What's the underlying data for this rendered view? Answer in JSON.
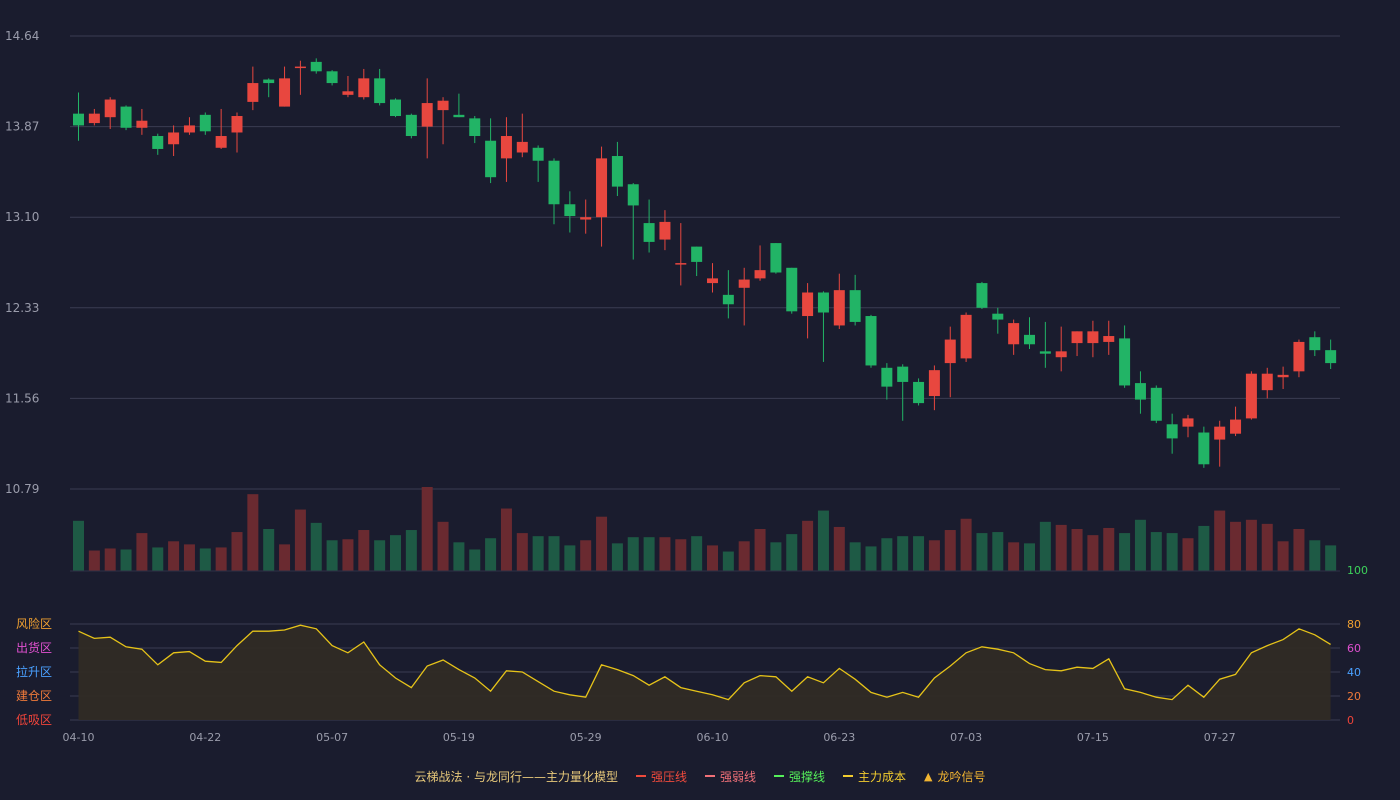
{
  "colors": {
    "background": "#1a1c2e",
    "up": "#e8473f",
    "down": "#22b466",
    "volume_up": "#6a2a30",
    "volume_down": "#1e5a45",
    "grid": "#3a3d52",
    "axis_text": "#9a9cab",
    "oscillator_line": "#e6c319",
    "oscillator_fill": "#302b25"
  },
  "chart_data": [
    {
      "type": "candlestick",
      "name": "price",
      "y_ticks": [
        "14.64",
        "13.87",
        "13.10",
        "12.33",
        "11.56",
        "10.79"
      ],
      "ylim": [
        10.79,
        14.64
      ],
      "x_tick_labels": [
        "04-10",
        "04-22",
        "05-07",
        "05-19",
        "05-29",
        "06-10",
        "06-23",
        "07-03",
        "07-15",
        "07-27"
      ],
      "x_tick_index": [
        0,
        8,
        16,
        24,
        32,
        40,
        48,
        56,
        64,
        72
      ],
      "grid": true,
      "candles": [
        [
          13.98,
          13.88,
          14.16,
          13.75
        ],
        [
          13.9,
          13.98,
          14.02,
          13.88
        ],
        [
          13.95,
          14.1,
          14.12,
          13.85
        ],
        [
          14.04,
          13.86,
          14.05,
          13.84
        ],
        [
          13.86,
          13.92,
          14.02,
          13.8
        ],
        [
          13.79,
          13.68,
          13.81,
          13.63
        ],
        [
          13.72,
          13.82,
          13.88,
          13.62
        ],
        [
          13.82,
          13.88,
          13.95,
          13.8
        ],
        [
          13.97,
          13.83,
          13.99,
          13.8
        ],
        [
          13.69,
          13.79,
          14.02,
          13.68
        ],
        [
          13.82,
          13.96,
          13.99,
          13.65
        ],
        [
          14.08,
          14.24,
          14.38,
          14.01
        ],
        [
          14.27,
          14.24,
          14.28,
          14.12
        ],
        [
          14.04,
          14.28,
          14.38,
          14.04
        ],
        [
          14.37,
          14.38,
          14.43,
          14.14
        ],
        [
          14.42,
          14.34,
          14.45,
          14.32
        ],
        [
          14.34,
          14.24,
          14.35,
          14.22
        ],
        [
          14.14,
          14.17,
          14.3,
          14.12
        ],
        [
          14.12,
          14.28,
          14.36,
          14.1
        ],
        [
          14.28,
          14.07,
          14.36,
          14.05
        ],
        [
          14.1,
          13.96,
          14.11,
          13.95
        ],
        [
          13.97,
          13.79,
          13.98,
          13.77
        ],
        [
          13.87,
          14.07,
          14.28,
          13.6
        ],
        [
          14.01,
          14.09,
          14.12,
          13.72
        ],
        [
          13.97,
          13.95,
          14.15,
          13.95
        ],
        [
          13.94,
          13.79,
          13.96,
          13.73
        ],
        [
          13.75,
          13.44,
          13.94,
          13.39
        ],
        [
          13.6,
          13.79,
          13.95,
          13.4
        ],
        [
          13.65,
          13.74,
          13.98,
          13.61
        ],
        [
          13.69,
          13.58,
          13.71,
          13.4
        ],
        [
          13.58,
          13.21,
          13.6,
          13.04
        ],
        [
          13.21,
          13.11,
          13.32,
          12.97
        ],
        [
          13.08,
          13.1,
          13.25,
          12.96
        ],
        [
          13.1,
          13.6,
          13.7,
          12.85
        ],
        [
          13.62,
          13.36,
          13.74,
          13.28
        ],
        [
          13.38,
          13.2,
          13.39,
          12.74
        ],
        [
          13.05,
          12.89,
          13.25,
          12.8
        ],
        [
          12.91,
          13.06,
          13.16,
          12.82
        ],
        [
          12.71,
          12.71,
          13.05,
          12.52
        ],
        [
          12.85,
          12.72,
          12.85,
          12.6
        ],
        [
          12.54,
          12.58,
          12.71,
          12.46
        ],
        [
          12.44,
          12.36,
          12.65,
          12.24
        ],
        [
          12.5,
          12.57,
          12.67,
          12.18
        ],
        [
          12.58,
          12.65,
          12.86,
          12.56
        ],
        [
          12.88,
          12.63,
          12.88,
          12.62
        ],
        [
          12.67,
          12.3,
          12.67,
          12.28
        ],
        [
          12.26,
          12.46,
          12.54,
          12.07
        ],
        [
          12.46,
          12.29,
          12.47,
          11.87
        ],
        [
          12.18,
          12.48,
          12.62,
          12.15
        ],
        [
          12.48,
          12.21,
          12.61,
          12.18
        ],
        [
          12.26,
          11.84,
          12.27,
          11.82
        ],
        [
          11.82,
          11.66,
          11.86,
          11.55
        ],
        [
          11.83,
          11.7,
          11.85,
          11.37
        ],
        [
          11.7,
          11.52,
          11.73,
          11.5
        ],
        [
          11.58,
          11.8,
          11.84,
          11.46
        ],
        [
          11.86,
          12.06,
          12.17,
          11.57
        ],
        [
          11.9,
          12.27,
          12.29,
          11.87
        ],
        [
          12.54,
          12.33,
          12.55,
          12.32
        ],
        [
          12.28,
          12.23,
          12.33,
          12.11
        ],
        [
          12.02,
          12.2,
          12.23,
          11.93
        ],
        [
          12.1,
          12.02,
          12.25,
          11.98
        ],
        [
          11.96,
          11.94,
          12.21,
          11.82
        ],
        [
          11.91,
          11.96,
          12.17,
          11.79
        ],
        [
          12.03,
          12.13,
          12.13,
          11.92
        ],
        [
          12.03,
          12.13,
          12.22,
          11.91
        ],
        [
          12.04,
          12.09,
          12.22,
          11.93
        ],
        [
          12.07,
          11.67,
          12.18,
          11.65
        ],
        [
          11.69,
          11.55,
          11.79,
          11.43
        ],
        [
          11.65,
          11.37,
          11.67,
          11.35
        ],
        [
          11.34,
          11.22,
          11.43,
          11.09
        ],
        [
          11.32,
          11.39,
          11.42,
          11.23
        ],
        [
          11.27,
          11.0,
          11.32,
          10.97
        ],
        [
          11.21,
          11.32,
          11.37,
          10.98
        ],
        [
          11.26,
          11.38,
          11.49,
          11.24
        ],
        [
          11.39,
          11.77,
          11.79,
          11.38
        ],
        [
          11.63,
          11.77,
          11.82,
          11.56
        ],
        [
          11.74,
          11.76,
          11.83,
          11.64
        ],
        [
          11.79,
          12.04,
          12.06,
          11.74
        ],
        [
          12.08,
          11.97,
          12.13,
          11.92
        ],
        [
          11.97,
          11.86,
          12.06,
          11.81
        ]
      ]
    },
    {
      "type": "bar",
      "name": "volume",
      "values": [
        49,
        20,
        22,
        21,
        37,
        23,
        29,
        26,
        22,
        23,
        38,
        75,
        41,
        26,
        60,
        47,
        30,
        31,
        40,
        30,
        35,
        40,
        82,
        48,
        28,
        21,
        32,
        61,
        37,
        34,
        34,
        25,
        30,
        53,
        27,
        33,
        33,
        33,
        31,
        34,
        25,
        19,
        29,
        41,
        28,
        36,
        49,
        59,
        43,
        28,
        24,
        32,
        34,
        34,
        30,
        40,
        51,
        37,
        38,
        28,
        27,
        48,
        45,
        41,
        35,
        42,
        37,
        50,
        38,
        37,
        32,
        44,
        59,
        48,
        50,
        46,
        29,
        41,
        30,
        25
      ]
    },
    {
      "type": "area",
      "name": "oscillator",
      "y_ticks": [
        100,
        80,
        60,
        40,
        20,
        0
      ],
      "ylim": [
        0,
        100
      ],
      "zones": [
        "风险区",
        "出货区",
        "拉升区",
        "建仓区",
        "低吸区"
      ],
      "values": [
        74,
        68,
        69,
        61,
        59,
        46,
        56,
        57,
        49,
        48,
        62,
        74,
        74,
        75,
        79,
        76,
        62,
        56,
        65,
        46,
        35,
        27,
        45,
        50,
        42,
        35,
        24,
        41,
        40,
        32,
        24,
        21,
        19,
        46,
        42,
        37,
        29,
        36,
        27,
        24,
        21,
        17,
        31,
        37,
        36,
        24,
        36,
        31,
        43,
        34,
        23,
        19,
        23,
        19,
        35,
        45,
        56,
        61,
        59,
        56,
        47,
        42,
        41,
        44,
        43,
        51,
        26,
        23,
        19,
        17,
        29,
        19,
        34,
        38,
        56,
        62,
        67,
        76,
        71,
        63
      ]
    }
  ],
  "legend": {
    "title": "云梯战法 · 与龙同行——主力量化模型",
    "items": [
      {
        "label": "强压线",
        "color": "#ef4a3c",
        "style": "solid"
      },
      {
        "label": "强弱线",
        "color": "#f07078",
        "style": "dashed"
      },
      {
        "label": "强撑线",
        "color": "#55f05a",
        "style": "solid"
      },
      {
        "label": "主力成本",
        "color": "#f2cc2f",
        "style": "dashed"
      },
      {
        "label": "龙吟信号",
        "color": "#f2b531",
        "style": "triangle"
      }
    ]
  }
}
